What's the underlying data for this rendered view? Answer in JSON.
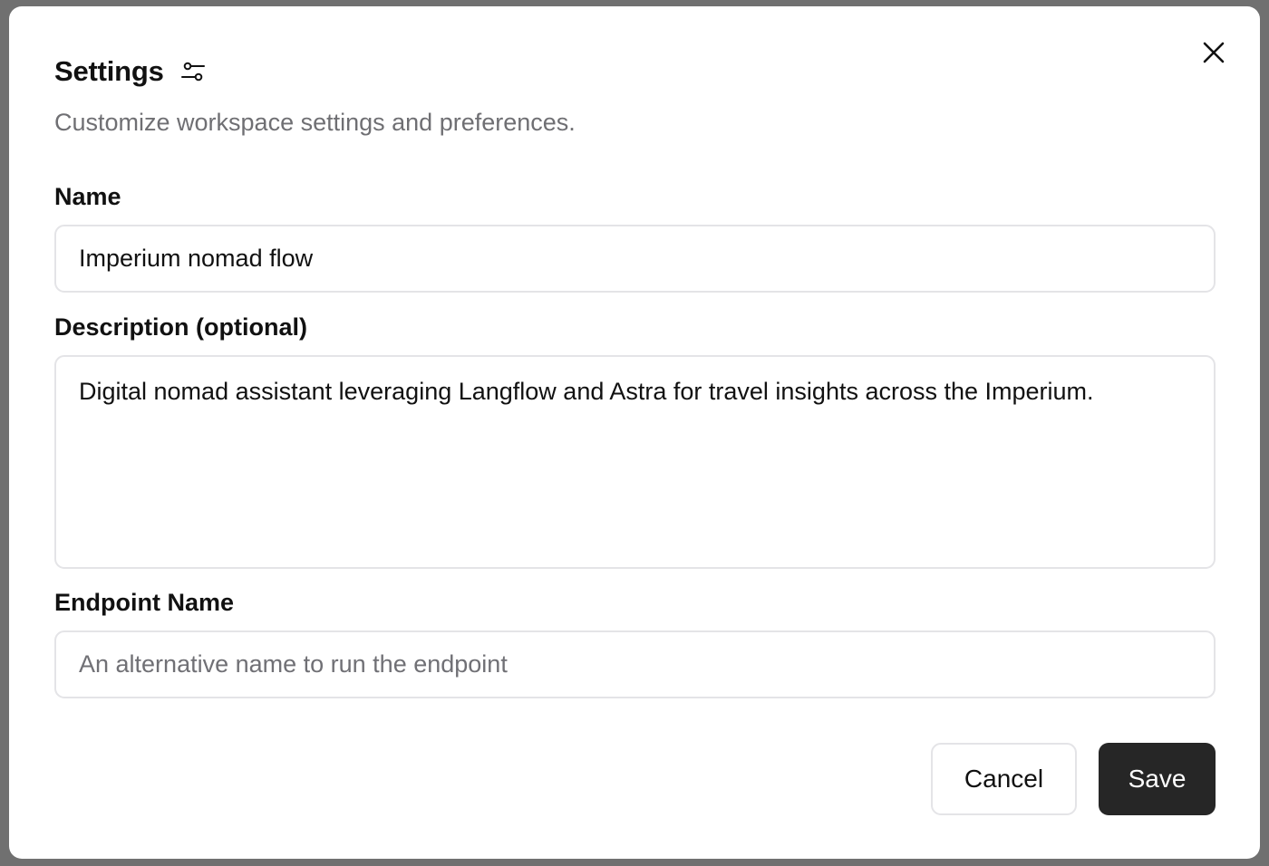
{
  "dialog": {
    "title": "Settings",
    "title_icon": "sliders-icon",
    "subtitle": "Customize workspace settings and preferences.",
    "close_icon": "close-icon"
  },
  "form": {
    "name": {
      "label": "Name",
      "value": "Imperium nomad flow"
    },
    "description": {
      "label": "Description (optional)",
      "value": "Digital nomad assistant leveraging Langflow and Astra for travel insights across the Imperium."
    },
    "endpoint": {
      "label": "Endpoint Name",
      "value": "",
      "placeholder": "An alternative name to run the endpoint"
    }
  },
  "actions": {
    "cancel_label": "Cancel",
    "save_label": "Save"
  },
  "colors": {
    "primary_button": "#262626",
    "border": "#e4e4e7",
    "muted_text": "#6f6f73"
  }
}
